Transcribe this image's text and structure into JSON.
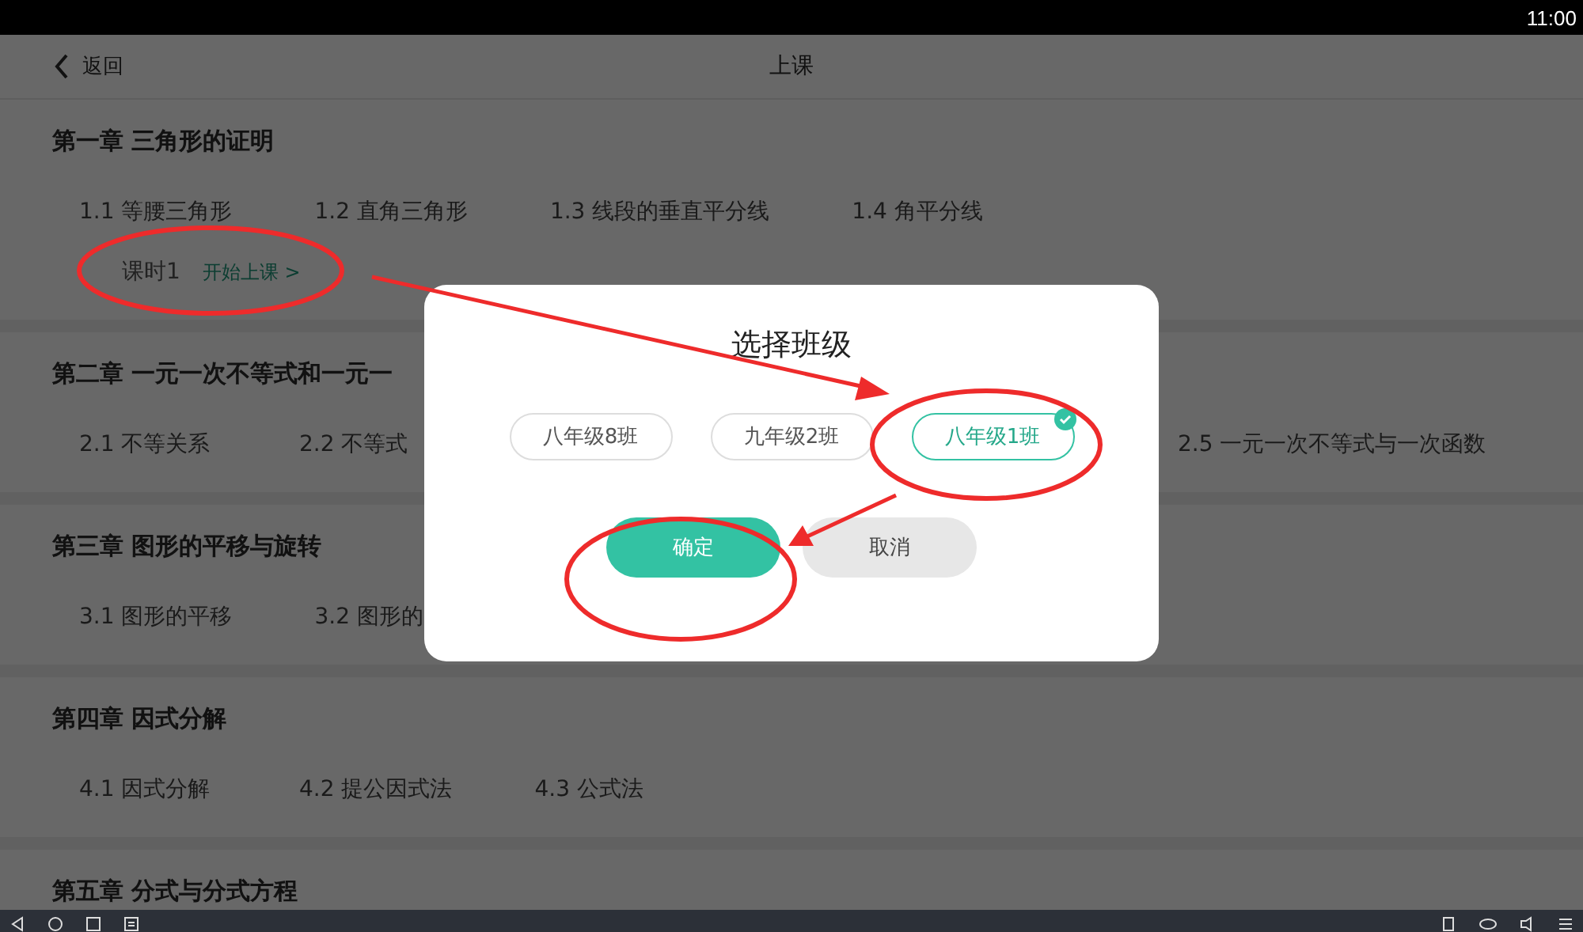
{
  "status_bar": {
    "time": "11:00"
  },
  "header": {
    "back": "返回",
    "title": "上课"
  },
  "chapters": [
    {
      "title": "第一章 三角形的证明",
      "sections": [
        {
          "label": "1.1 等腰三角形"
        },
        {
          "label": "1.2 直角三角形"
        },
        {
          "label": "1.3 线段的垂直平分线"
        },
        {
          "label": "1.4 角平分线"
        }
      ],
      "lesson": {
        "label": "课时1",
        "action": "开始上课 >"
      }
    },
    {
      "title": "第二章 一元一次不等式和一元一",
      "sections": [
        {
          "label": "2.1 不等关系"
        },
        {
          "label": "2.2 不等式"
        },
        {
          "label": "2.5 一元一次不等式与一次函数",
          "obscured_before": true
        }
      ]
    },
    {
      "title": "第三章 图形的平移与旋转",
      "sections": [
        {
          "label": "3.1 图形的平移"
        },
        {
          "label": "3.2 图形的"
        }
      ]
    },
    {
      "title": "第四章 因式分解",
      "sections": [
        {
          "label": "4.1 因式分解"
        },
        {
          "label": "4.2 提公因式法"
        },
        {
          "label": "4.3 公式法"
        }
      ]
    },
    {
      "title": "第五章 分式与分式方程"
    }
  ],
  "dialog": {
    "title": "选择班级",
    "classes": [
      {
        "label": "八年级8班",
        "selected": false
      },
      {
        "label": "九年级2班",
        "selected": false
      },
      {
        "label": "八年级1班",
        "selected": true
      }
    ],
    "buttons": [
      {
        "label": "确定",
        "kind": "primary"
      },
      {
        "label": "取消",
        "kind": "secondary"
      }
    ]
  }
}
